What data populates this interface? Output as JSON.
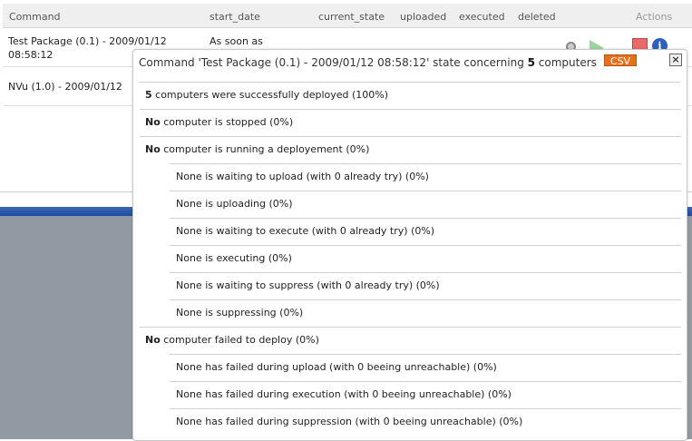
{
  "table": {
    "headers": {
      "command": "Command",
      "start_date": "start_date",
      "current_state": "current_state",
      "uploaded": "uploaded",
      "executed": "executed",
      "deleted": "deleted",
      "actions": "Actions"
    },
    "rows": [
      {
        "command_line1": "Test Package (0.1) - 2009/01/12",
        "command_line2": "08:58:12",
        "start_date": "As soon as"
      },
      {
        "command_line1": "NVu (1.0) - 2009/01/12"
      }
    ]
  },
  "popup": {
    "title_prefix": "Command 'Test Package (0.1) - 2009/01/12 08:58:12' state concerning ",
    "title_count": "5",
    "title_suffix": " computers",
    "csv_label": "CSV",
    "close_label": "×",
    "lines": [
      {
        "bold": "5",
        "text": " computers were successfully deployed (100%)"
      },
      {
        "bold": "No",
        "text": " computer is stopped (0%)"
      },
      {
        "bold": "No",
        "text": " computer is running a deployement (0%)"
      },
      {
        "text": "None is waiting to upload (with 0 already try) (0%)"
      },
      {
        "text": "None is uploading (0%)"
      },
      {
        "text": "None is waiting to execute (with 0 already try) (0%)"
      },
      {
        "text": "None is executing (0%)"
      },
      {
        "text": "None is waiting to suppress (with 0 already try) (0%)"
      },
      {
        "text": "None is suppressing (0%)"
      },
      {
        "bold": "No",
        "text": " computer failed to deploy (0%)"
      },
      {
        "text": "None has failed during upload (with 0 beeing unreachable) (0%)"
      },
      {
        "text": "None has failed during execution (with 0 beeing unreachable) (0%)"
      },
      {
        "text": "None has failed during suppression (with 0 beeing unreachable) (0%)"
      }
    ]
  }
}
